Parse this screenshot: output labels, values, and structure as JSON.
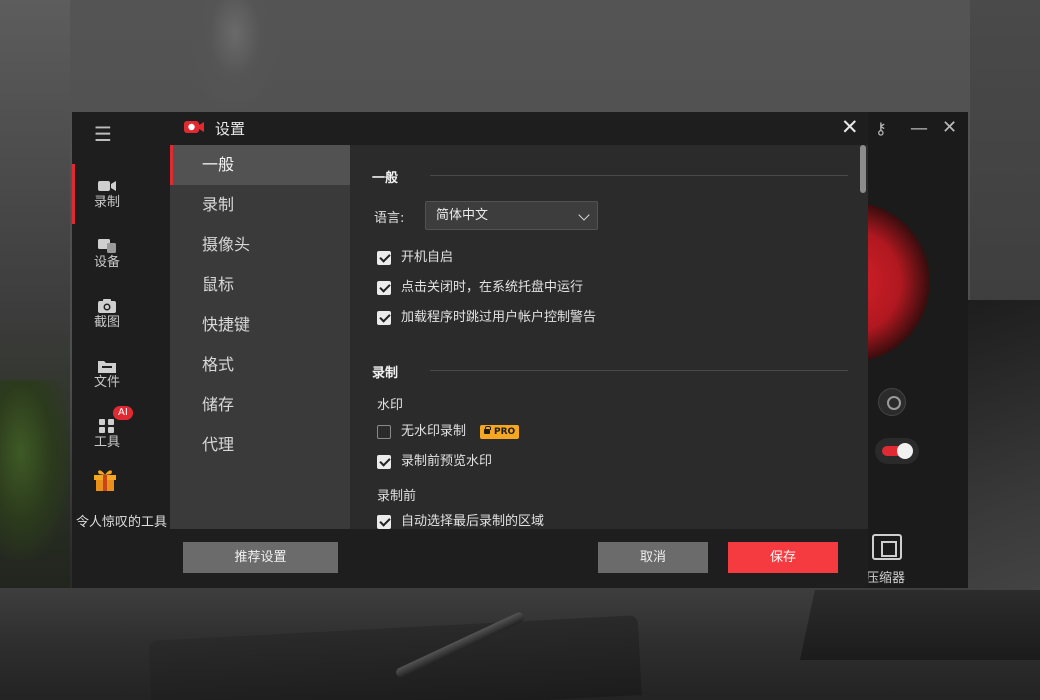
{
  "app": {
    "sidebar": {
      "items": [
        {
          "label": "录制",
          "icon": "video-camera-icon"
        },
        {
          "label": "设备",
          "icon": "devices-icon"
        },
        {
          "label": "截图",
          "icon": "camera-icon"
        },
        {
          "label": "文件",
          "icon": "folder-icon"
        },
        {
          "label": "工具",
          "icon": "grid-tools-icon"
        }
      ],
      "ai_badge": "AI",
      "amazing_tools": "令人惊叹的工具"
    },
    "compressor_label": "压缩器"
  },
  "dialog": {
    "title": "设置",
    "nav": [
      {
        "label": "一般",
        "active": true
      },
      {
        "label": "录制",
        "active": false
      },
      {
        "label": "摄像头",
        "active": false
      },
      {
        "label": "鼠标",
        "active": false
      },
      {
        "label": "快捷键",
        "active": false
      },
      {
        "label": "格式",
        "active": false
      },
      {
        "label": "储存",
        "active": false
      },
      {
        "label": "代理",
        "active": false
      }
    ],
    "general": {
      "section_title": "一般",
      "language_label": "语言:",
      "language_value": "简体中文",
      "options": [
        {
          "label": "开机自启",
          "checked": true
        },
        {
          "label": "点击关闭时，在系统托盘中运行",
          "checked": true
        },
        {
          "label": "加载程序时跳过用户帐户控制警告",
          "checked": true
        }
      ]
    },
    "recording": {
      "section_title": "录制",
      "watermark_label": "水印",
      "watermark_options": [
        {
          "label": "无水印录制",
          "checked": false,
          "badge": "PRO"
        },
        {
          "label": "录制前预览水印",
          "checked": true
        }
      ],
      "before_label": "录制前",
      "before_options": [
        {
          "label": "自动选择最后录制的区域",
          "checked": true
        }
      ]
    },
    "footer": {
      "recommend": "推荐设置",
      "cancel": "取消",
      "save": "保存"
    }
  },
  "colors": {
    "accent": "#e02a32",
    "save_button": "#f53a40",
    "pro_badge": "#f5a623"
  }
}
